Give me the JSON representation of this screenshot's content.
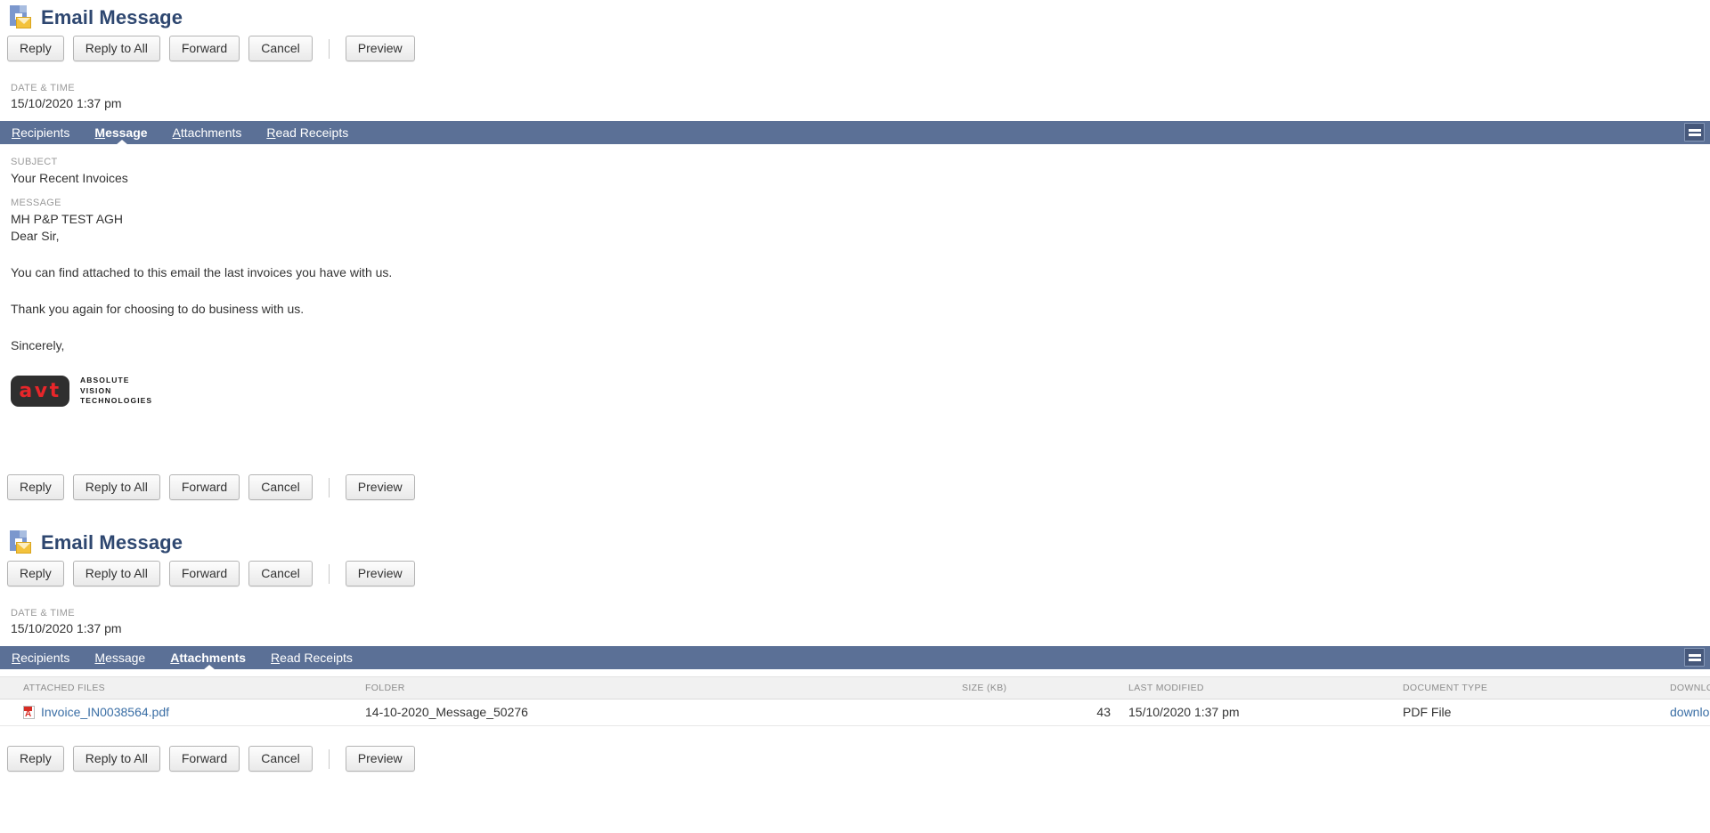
{
  "sections": [
    {
      "title": "Email Message",
      "icon": "email-document-icon",
      "date_label": "DATE & TIME",
      "date_value": "15/10/2020 1:37 pm",
      "active_tab": "Message"
    },
    {
      "title": "Email Message",
      "icon": "email-document-icon",
      "date_label": "DATE & TIME",
      "date_value": "15/10/2020 1:37 pm",
      "active_tab": "Attachments"
    }
  ],
  "toolbar": {
    "reply": "Reply",
    "reply_all": "Reply to All",
    "forward": "Forward",
    "cancel": "Cancel",
    "preview": "Preview"
  },
  "tabs": [
    {
      "label": "Recipients",
      "accesskey": "R",
      "rest": "ecipients"
    },
    {
      "label": "Message",
      "accesskey": "M",
      "rest": "essage"
    },
    {
      "label": "Attachments",
      "accesskey": "A",
      "rest": "ttachments"
    },
    {
      "label": "Read Receipts",
      "accesskey": "R",
      "rest": "ead Receipts"
    }
  ],
  "message": {
    "subject_label": "SUBJECT",
    "subject": "Your Recent Invoices",
    "message_label": "MESSAGE",
    "line1": "MH P&P TEST AGH",
    "line2": "Dear Sir,",
    "para1": "You can find attached to this email the last invoices you have with us.",
    "para2": "Thank you again for choosing to do business with us.",
    "para3": "Sincerely,"
  },
  "signature": {
    "logo_text": "avt",
    "word1": "ABSOLUTE",
    "word2": "VISION",
    "word3": "TECHNOLOGIES"
  },
  "attachments": {
    "columns": [
      "ATTACHED FILES",
      "FOLDER",
      "SIZE (KB)",
      "LAST MODIFIED",
      "DOCUMENT TYPE",
      "DOWNLOAD"
    ],
    "rows": [
      {
        "file": "Invoice_IN0038564.pdf",
        "folder": "14-10-2020_Message_50276",
        "size": "43",
        "last_modified": "15/10/2020 1:37 pm",
        "doc_type": "PDF File",
        "download": "download"
      }
    ]
  },
  "colors": {
    "tabbar": "#5b7096",
    "title": "#2e4770",
    "link": "#3a6ea5",
    "logo_red": "#e8262a"
  },
  "menu_icon": "hamburger-menu-icon"
}
